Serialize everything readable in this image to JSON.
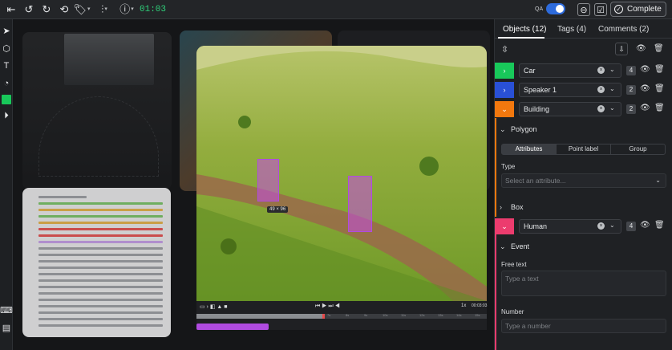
{
  "topbar": {
    "time": "01:03",
    "qa_label": "QA",
    "complete_label": "Complete"
  },
  "colors": {
    "car": "#18c85a",
    "speaker": "#2950d6",
    "building": "#f2780e",
    "human": "#ec3c6e",
    "accent": "#2d6bdc",
    "bbox": "#c64ae6"
  },
  "video": {
    "bbox_size_label": "49 × 96",
    "speed": "1x",
    "timecode": "00:03:03"
  },
  "timeline": {
    "ticks": [
      "0s",
      "1s",
      "2s",
      "3s",
      "4s",
      "5s",
      "6s",
      "7s",
      "8s",
      "9s",
      "10s",
      "11s",
      "12s",
      "13s",
      "14s",
      "15s"
    ]
  },
  "panel": {
    "tabs": [
      {
        "label": "Objects (12)"
      },
      {
        "label": "Tags (4)"
      },
      {
        "label": "Comments (2)"
      }
    ],
    "objects": [
      {
        "name": "Car",
        "count": "4"
      },
      {
        "name": "Speaker 1",
        "count": "2"
      },
      {
        "name": "Building",
        "count": "2"
      },
      {
        "name": "Human",
        "count": "4"
      }
    ],
    "polygon_label": "Polygon",
    "segments": [
      "Attributes",
      "Point label",
      "Group"
    ],
    "type_label": "Type",
    "type_placeholder": "Select an attribute...",
    "box_label": "Box",
    "event_label": "Event",
    "free_text_label": "Free text",
    "free_text_placeholder": "Type a text",
    "number_label": "Number",
    "number_placeholder": "Type a number"
  }
}
